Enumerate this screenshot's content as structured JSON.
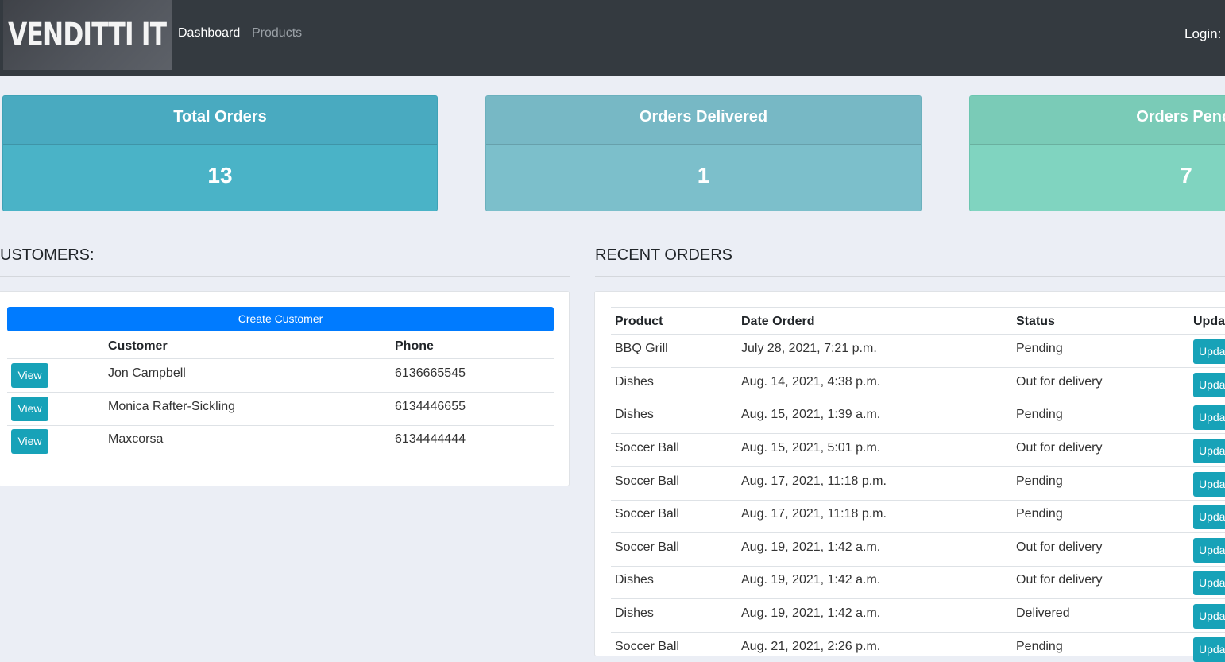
{
  "nav": {
    "brand": "VENDITTI IT",
    "links": [
      "Dashboard",
      "Products"
    ],
    "login": "Login:"
  },
  "stats": [
    {
      "title": "Total Orders",
      "value": "13"
    },
    {
      "title": "Orders Delivered",
      "value": "1"
    },
    {
      "title": "Orders Pendi",
      "value": "7"
    }
  ],
  "customers": {
    "title": "USTOMERS:",
    "create_label": "Create Customer",
    "headers": [
      "Customer",
      "Phone"
    ],
    "view_label": "View",
    "rows": [
      {
        "name": "Jon Campbell",
        "phone": "6136665545"
      },
      {
        "name": "Monica Rafter-Sickling",
        "phone": "6134446655"
      },
      {
        "name": "Maxcorsa",
        "phone": "6134444444"
      }
    ]
  },
  "orders": {
    "title": "RECENT ORDERS",
    "headers": [
      "Product",
      "Date Orderd",
      "Status",
      "Upda"
    ],
    "update_label": "Upda",
    "rows": [
      {
        "product": "BBQ Grill",
        "date": "July 28, 2021, 7:21 p.m.",
        "status": "Pending"
      },
      {
        "product": "Dishes",
        "date": "Aug. 14, 2021, 4:38 p.m.",
        "status": "Out for delivery"
      },
      {
        "product": "Dishes",
        "date": "Aug. 15, 2021, 1:39 a.m.",
        "status": "Pending"
      },
      {
        "product": "Soccer Ball",
        "date": "Aug. 15, 2021, 5:01 p.m.",
        "status": "Out for delivery"
      },
      {
        "product": "Soccer Ball",
        "date": "Aug. 17, 2021, 11:18 p.m.",
        "status": "Pending"
      },
      {
        "product": "Soccer Ball",
        "date": "Aug. 17, 2021, 11:18 p.m.",
        "status": "Pending"
      },
      {
        "product": "Soccer Ball",
        "date": "Aug. 19, 2021, 1:42 a.m.",
        "status": "Out for delivery"
      },
      {
        "product": "Dishes",
        "date": "Aug. 19, 2021, 1:42 a.m.",
        "status": "Out for delivery"
      },
      {
        "product": "Dishes",
        "date": "Aug. 19, 2021, 1:42 a.m.",
        "status": "Delivered"
      },
      {
        "product": "Soccer Ball",
        "date": "Aug. 21, 2021, 2:26 p.m.",
        "status": "Pending"
      }
    ]
  }
}
